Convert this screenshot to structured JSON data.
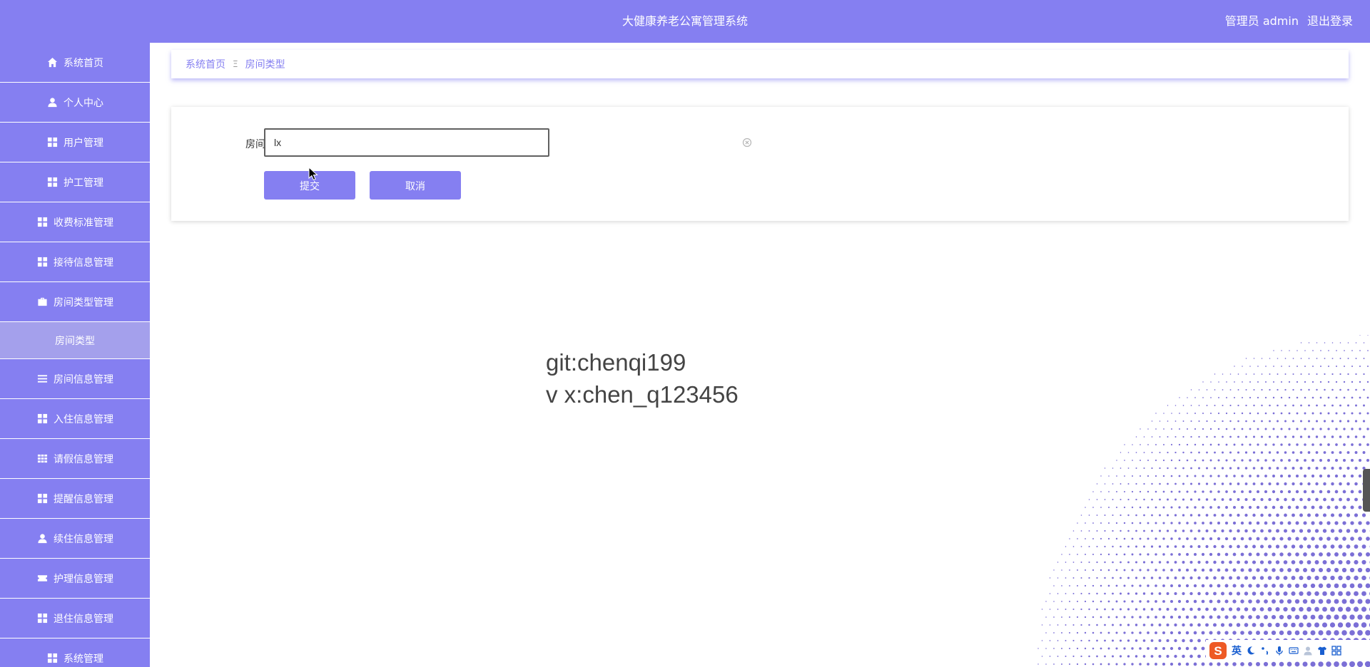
{
  "header": {
    "title": "大健康养老公寓管理系统",
    "user_label": "管理员 admin",
    "logout_label": "退出登录"
  },
  "sidebar": {
    "items": [
      {
        "label": "系统首页",
        "icon": "home-icon"
      },
      {
        "label": "个人中心",
        "icon": "user-icon"
      },
      {
        "label": "用户管理",
        "icon": "grid-icon"
      },
      {
        "label": "护工管理",
        "icon": "grid-icon"
      },
      {
        "label": "收费标准管理",
        "icon": "grid-icon"
      },
      {
        "label": "接待信息管理",
        "icon": "grid-icon"
      },
      {
        "label": "房间类型管理",
        "icon": "briefcase-icon"
      },
      {
        "label": "房间信息管理",
        "icon": "list-icon"
      },
      {
        "label": "入住信息管理",
        "icon": "grid-icon"
      },
      {
        "label": "请假信息管理",
        "icon": "table-icon"
      },
      {
        "label": "提醒信息管理",
        "icon": "grid-icon"
      },
      {
        "label": "续住信息管理",
        "icon": "user-icon"
      },
      {
        "label": "护理信息管理",
        "icon": "ticket-icon"
      },
      {
        "label": "退住信息管理",
        "icon": "grid-icon"
      },
      {
        "label": "系统管理",
        "icon": "grid-icon"
      }
    ],
    "submenu": {
      "label": "房间类型"
    }
  },
  "breadcrumb": {
    "home": "系统首页",
    "separator": "Ξ",
    "current": "房间类型"
  },
  "form": {
    "field_label": "房间类型",
    "field_value": "lx",
    "submit_label": "提交",
    "cancel_label": "取消"
  },
  "watermark": {
    "line1": "git:chenqi199",
    "line2": "v x:chen_q123456"
  },
  "ime": {
    "logo": "S",
    "lang": "英"
  },
  "colors": {
    "primary": "#857ff1",
    "submenu_bg": "#a4a0ec",
    "halftone": "#7b6fd6"
  }
}
